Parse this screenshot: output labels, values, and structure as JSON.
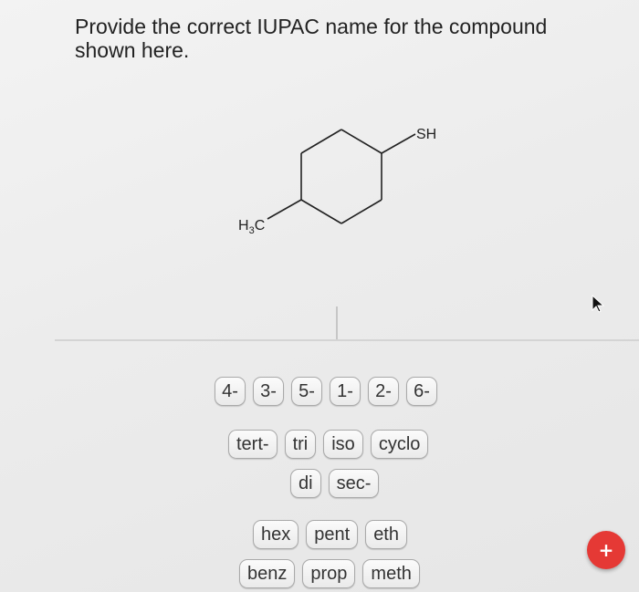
{
  "question": {
    "text": "Provide the correct IUPAC name for the compound shown here."
  },
  "structure": {
    "substituent_top": "SH",
    "methyl_main": "H",
    "methyl_sub": "3",
    "methyl_end": "C"
  },
  "tiles": {
    "locants": [
      "4-",
      "3-",
      "5-",
      "1-",
      "2-",
      "6-"
    ],
    "prefixes": [
      "tert-",
      "tri",
      "iso",
      "cyclo"
    ],
    "multipliers": [
      "di",
      "sec-"
    ],
    "roots_row1": [
      "hex",
      "pent",
      "eth"
    ],
    "roots_row2": [
      "benz",
      "prop",
      "meth"
    ]
  },
  "add_button": {
    "label": "+",
    "color": "#e53935"
  },
  "icons": {
    "pointer": "mouse-pointer-icon",
    "add": "plus-icon"
  }
}
